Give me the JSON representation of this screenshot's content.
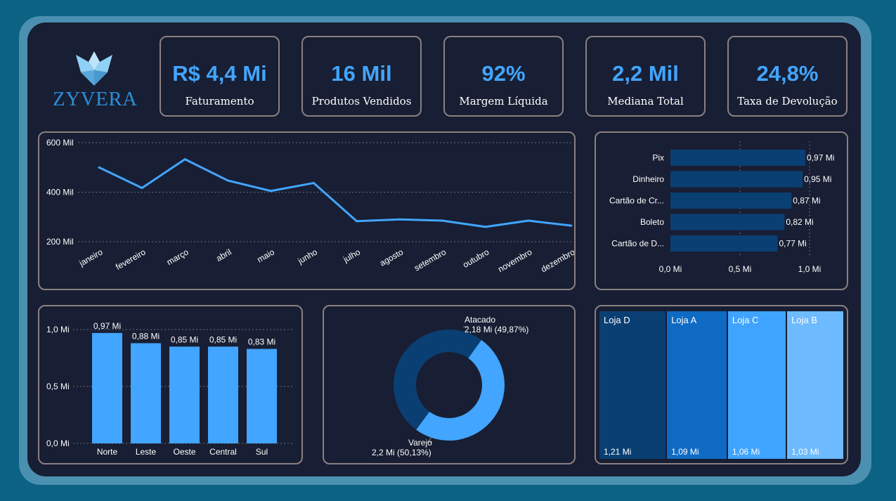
{
  "brand": {
    "name": "ZYVERA"
  },
  "kpis": [
    {
      "value": "R$ 4,4 Mi",
      "label": "Faturamento"
    },
    {
      "value": "16 Mil",
      "label": "Produtos Vendidos"
    },
    {
      "value": "92%",
      "label": "Margem Líquida"
    },
    {
      "value": "2,2 Mil",
      "label": "Mediana Total"
    },
    {
      "value": "24,8%",
      "label": "Taxa de Devolução"
    }
  ],
  "colors": {
    "accent": "#42a5ff",
    "dark_blue": "#0a3f73",
    "bar_blue": "#42a5ff"
  },
  "chart_data": [
    {
      "type": "line",
      "x": [
        "janeiro",
        "fevereiro",
        "março",
        "abril",
        "maio",
        "junho",
        "julho",
        "agosto",
        "setembro",
        "outubro",
        "novembro",
        "dezembro"
      ],
      "series": [
        {
          "values": [
            500,
            417,
            533,
            447,
            405,
            437,
            283,
            290,
            285,
            260,
            285,
            265
          ]
        }
      ],
      "y_ticks": [
        "600 Mil",
        "400 Mil",
        "200 Mil"
      ],
      "ylim": [
        200,
        600
      ],
      "grid": true
    },
    {
      "type": "bar",
      "orientation": "horizontal",
      "categories": [
        "Pix",
        "Dinheiro",
        "Cartão de Cr...",
        "Boleto",
        "Cartão de D..."
      ],
      "values": [
        0.97,
        0.95,
        0.87,
        0.82,
        0.77
      ],
      "data_labels": [
        "0,97 Mi",
        "0,95 Mi",
        "0,87 Mi",
        "0,82 Mi",
        "0,77 Mi"
      ],
      "x_ticks": [
        "0,0 Mi",
        "0,5 Mi",
        "1,0 Mi"
      ],
      "xlim": [
        0,
        1.0
      ],
      "grid": true
    },
    {
      "type": "bar",
      "categories": [
        "Norte",
        "Leste",
        "Oeste",
        "Central",
        "Sul"
      ],
      "values": [
        0.97,
        0.88,
        0.85,
        0.85,
        0.83
      ],
      "data_labels": [
        "0,97 Mi",
        "0,88 Mi",
        "0,85 Mi",
        "0,85 Mi",
        "0,83 Mi"
      ],
      "y_ticks": [
        "1,0 Mi",
        "0,5 Mi",
        "0,0 Mi"
      ],
      "ylim": [
        0,
        1.0
      ],
      "grid": true
    },
    {
      "type": "pie",
      "donut": true,
      "categories": [
        "Atacado",
        "Varejo"
      ],
      "values": [
        2.18,
        2.2
      ],
      "percentages": [
        49.87,
        50.13
      ],
      "data_labels": [
        "2,18 Mi (49,87%)",
        "2,2 Mi (50,13%)"
      ]
    },
    {
      "type": "treemap",
      "categories": [
        "Loja D",
        "Loja A",
        "Loja C",
        "Loja B"
      ],
      "values": [
        1.21,
        1.09,
        1.06,
        1.03
      ],
      "data_labels": [
        "1,21 Mi",
        "1,09 Mi",
        "1,06 Mi",
        "1,03 Mi"
      ],
      "colors": [
        "#0a3f73",
        "#0f6ac4",
        "#3fa4ff",
        "#6ebaff"
      ]
    }
  ]
}
